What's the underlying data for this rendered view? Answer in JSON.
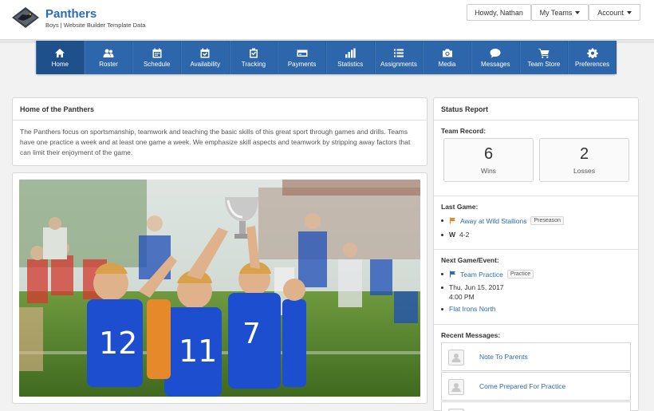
{
  "brand": {
    "title": "Panthers",
    "subtitle": "Boys | Website Builder Template Data"
  },
  "top": {
    "user": "Howdy, Nathan",
    "teams": "My Teams",
    "account": "Account"
  },
  "nav": [
    {
      "label": "Home",
      "icon": "home-icon"
    },
    {
      "label": "Roster",
      "icon": "users-icon"
    },
    {
      "label": "Schedule",
      "icon": "calendar-icon"
    },
    {
      "label": "Availability",
      "icon": "calendar-check-icon"
    },
    {
      "label": "Tracking",
      "icon": "clipboard-icon"
    },
    {
      "label": "Payments",
      "icon": "credit-card-icon"
    },
    {
      "label": "Statistics",
      "icon": "bar-chart-icon"
    },
    {
      "label": "Assignments",
      "icon": "list-icon"
    },
    {
      "label": "Media",
      "icon": "camera-icon"
    },
    {
      "label": "Messages",
      "icon": "chat-icon"
    },
    {
      "label": "Team Store",
      "icon": "cart-icon"
    },
    {
      "label": "Preferences",
      "icon": "gear-icon"
    }
  ],
  "home": {
    "title": "Home of the Panthers",
    "description": "The Panthers focus on sportsmanship, teamwork and teaching the basic skills of this great sport through games and drills. Teams have one practice a week and at least one game a week. We emphasize skill aspects and teamwork by stripping away factors that can limit their enjoyment of the game."
  },
  "status": {
    "title": "Status Report",
    "record_label": "Team Record:",
    "wins": "6",
    "wins_label": "Wins",
    "losses": "2",
    "losses_label": "Losses",
    "last_game_label": "Last Game:",
    "last_game": "Away at Wild Stallions",
    "last_game_tag": "Preseason",
    "result_letter": "W",
    "result_score": "4-2",
    "next_label": "Next Game/Event:",
    "next_event": "Team Practice",
    "next_tag": "Practice",
    "next_date": "Thu, Jun 15, 2017",
    "next_time": "4:00 PM",
    "next_location": "Flat Irons North",
    "messages_label": "Recent Messages:",
    "messages": [
      "Note To Parents",
      "Come Prepared For Practice"
    ]
  },
  "colors": {
    "accent": "#2d66ab",
    "link": "#2a6bb3",
    "flag_last": "#e58a25",
    "flag_next": "#2a6bb3"
  }
}
